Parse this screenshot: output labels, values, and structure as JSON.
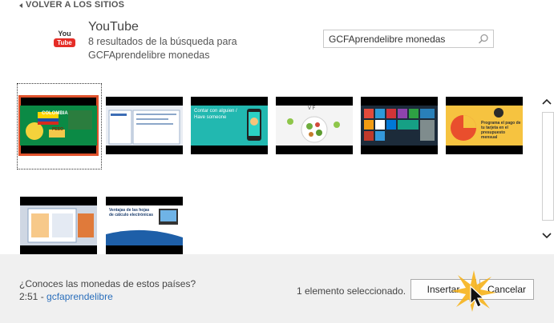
{
  "nav": {
    "back_label": "VOLVER A LOS SITIOS"
  },
  "service": {
    "logo_you": "You",
    "logo_tube": "Tube",
    "title": "YouTube",
    "result_text": "8 resultados de la búsqueda para GCFAprendelibre monedas"
  },
  "search": {
    "value": "GCFAprendelibre monedas",
    "icon": "search-icon"
  },
  "thumbnails": [
    {
      "id": "thumb-1",
      "selected": true,
      "caption": "COLOMBIA",
      "caption2": "PESO",
      "bg": "#0b7a3d"
    },
    {
      "id": "thumb-2",
      "selected": false,
      "bg": "#dfe7f1"
    },
    {
      "id": "thumb-3",
      "selected": false,
      "caption": "Contar con alguien / Have someone",
      "bg": "#1fb7b0"
    },
    {
      "id": "thumb-4",
      "selected": false,
      "caption": "V F",
      "bg": "#f2f2f2"
    },
    {
      "id": "thumb-5",
      "selected": false,
      "bg": "#1c2b3a"
    },
    {
      "id": "thumb-6",
      "selected": false,
      "caption": "Programa el pago de tu tarjeta en el presupuesto mensual",
      "bg": "#f5c33b"
    },
    {
      "id": "thumb-7",
      "selected": false,
      "bg": "#d8dde6"
    },
    {
      "id": "thumb-8",
      "selected": false,
      "caption": "Ventajas de las hojas de cálculo electrónicas",
      "bg": "#ffffff"
    }
  ],
  "footer": {
    "description": "¿Conoces las monedas de estos países?",
    "duration": "2:51",
    "separator": " - ",
    "channel": "gcfaprendelibre",
    "selection_text": "1 elemento seleccionado.",
    "insert_label": "Insertar",
    "cancel_label": "Cancelar"
  },
  "colors": {
    "accent": "#e0522c",
    "link": "#2a6ebb",
    "footer_bg": "#f0f0f0"
  }
}
